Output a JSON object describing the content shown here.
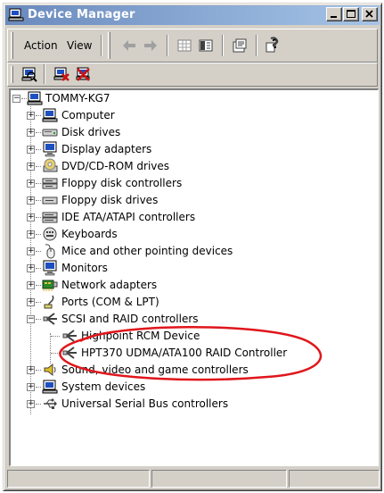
{
  "window": {
    "title": "Device Manager"
  },
  "menu": {
    "action": "Action",
    "view": "View"
  },
  "tree": {
    "root": "TOMMY-KG7",
    "categories": [
      "Computer",
      "Disk drives",
      "Display adapters",
      "DVD/CD-ROM drives",
      "Floppy disk controllers",
      "Floppy disk drives",
      "IDE ATA/ATAPI controllers",
      "Keyboards",
      "Mice and other pointing devices",
      "Monitors",
      "Network adapters",
      "Ports (COM & LPT)",
      "SCSI and RAID controllers",
      "Sound, video and game controllers",
      "System devices",
      "Universal Serial Bus controllers"
    ],
    "scsi_children": [
      "Highpoint RCM Device",
      "HPT370 UDMA/ATA100 RAID Controller"
    ]
  },
  "annotation": {
    "color": "#e0161c"
  }
}
